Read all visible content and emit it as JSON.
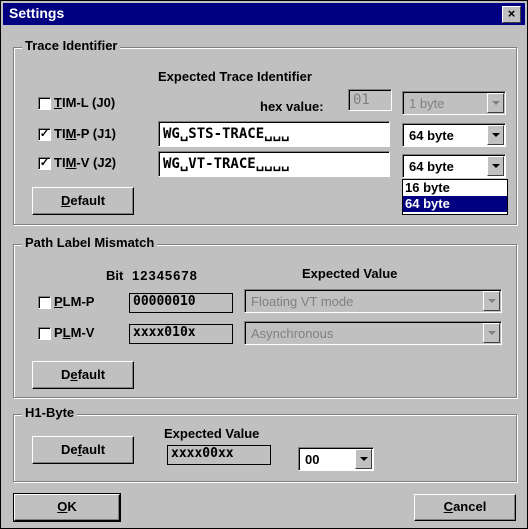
{
  "window": {
    "title": "Settings",
    "close": "×"
  },
  "trace": {
    "group": "Trace Identifier",
    "expected_header": "Expected Trace Identifier",
    "hex_label": "hex value:",
    "hex_value": "01",
    "rows": [
      {
        "label_pre": "",
        "label_u": "T",
        "label_post": "IM-L (J0)",
        "checked": false,
        "value": "",
        "combo": "1 byte",
        "disabled": true
      },
      {
        "label_pre": "TI",
        "label_u": "M",
        "label_post": "-P (J1)",
        "checked": true,
        "value": "WG␣STS-TRACE␣␣␣",
        "combo": "64 byte",
        "disabled": false
      },
      {
        "label_pre": "TI",
        "label_u": "M",
        "label_post": "-V (J2)",
        "checked": true,
        "value": "WG␣VT-TRACE␣␣␣␣",
        "combo": "64 byte",
        "disabled": false
      }
    ],
    "default_pre": "",
    "default_u": "D",
    "default_post": "efault",
    "dropdown": [
      "16 byte",
      "64 byte"
    ]
  },
  "plm": {
    "group": "Path Label Mismatch",
    "bit_label": "Bit",
    "bits": "12345678",
    "expected_header": "Expected Value",
    "rows": [
      {
        "label_pre": "",
        "label_u": "P",
        "label_post": "LM-P",
        "bits": "00000010",
        "combo": "Floating VT mode"
      },
      {
        "label_pre": "P",
        "label_u": "L",
        "label_post": "M-V",
        "bits": "xxxx010x",
        "combo": "Asynchronous"
      }
    ],
    "default_pre": "D",
    "default_u": "e",
    "default_post": "fault"
  },
  "h1": {
    "group": "H1-Byte",
    "expected_header": "Expected Value",
    "default_pre": "De",
    "default_u": "f",
    "default_post": "ault",
    "bits": "xxxx00xx",
    "combo": "00"
  },
  "footer": {
    "ok_u": "O",
    "ok_post": "K",
    "cancel_u": "C",
    "cancel_post": "ancel"
  }
}
